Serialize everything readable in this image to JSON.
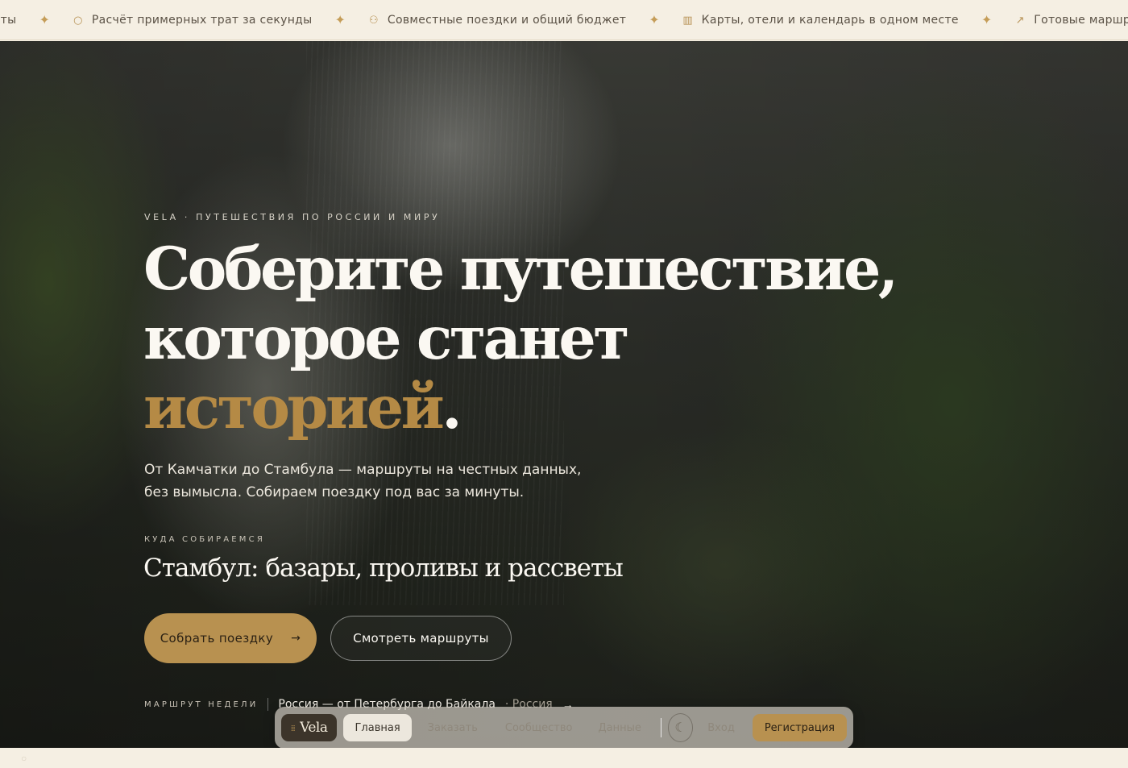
{
  "ticker": {
    "items": [
      {
        "icon": "circle-icon",
        "glyph": "○",
        "text": "Документы"
      },
      {
        "icon": "circle-icon",
        "glyph": "○",
        "text": "Расчёт примерных трат за секунды"
      },
      {
        "icon": "users-icon",
        "glyph": "⚇",
        "text": "Совместные поездки и общий бюджет"
      },
      {
        "icon": "map-icon",
        "glyph": "▥",
        "text": "Карты, отели и календарь в одном месте"
      },
      {
        "icon": "route-icon",
        "glyph": "↗",
        "text": "Готовые маршруты на честных данных"
      }
    ],
    "separator": "✦"
  },
  "hero": {
    "eyebrow": "VELA · ПУТЕШЕСТВИЯ ПО РОССИИ И МИРУ",
    "title_line1": "Соберите путешествие,",
    "title_line2": "которое станет",
    "title_accent": "историей",
    "title_end": ".",
    "lead": "От Камчатки до Стамбула — маршруты на честных данных, без вымысла. Собираем поездку под вас за минуты.",
    "destination_label": "КУДА СОБИРАЕМСЯ",
    "destination": "Стамбул: базары, проливы и рассветы",
    "cta_primary": "Собрать поездку",
    "cta_secondary": "Смотреть маршруты",
    "route_label": "МАРШРУТ НЕДЕЛИ",
    "route_title": "Россия — от Петербурга до Байкала",
    "route_region": "· Россия"
  },
  "nav": {
    "brand": "Vela",
    "items": [
      "Главная",
      "Заказать",
      "Сообщество",
      "Данные"
    ],
    "login": "Вход",
    "register": "Регистрация"
  },
  "colors": {
    "accent": "#b89150",
    "background": "#f5efe3"
  }
}
